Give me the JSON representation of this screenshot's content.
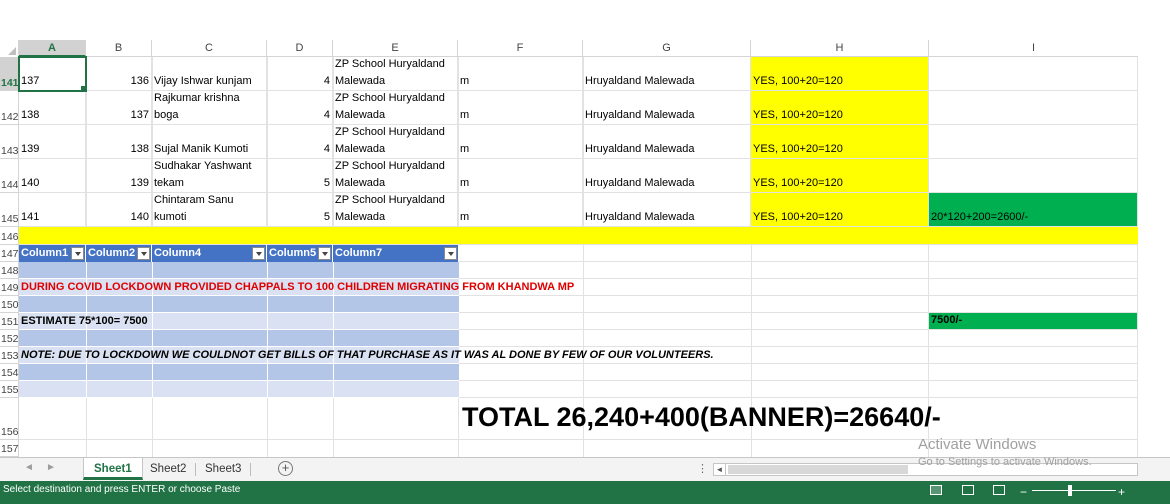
{
  "columns": [
    "A",
    "B",
    "C",
    "D",
    "E",
    "F",
    "G",
    "H",
    "I"
  ],
  "selected_column": "A",
  "rows": [
    {
      "num": "141",
      "a": "137",
      "b": "136",
      "c": [
        "Vijay Ishwar kunjam"
      ],
      "d": "4",
      "e": [
        "ZP School Huryaldand",
        "Malewada"
      ],
      "f": "m",
      "g": "Hruyaldand Malewada",
      "h": "YES, 100+20=120",
      "i": ""
    },
    {
      "num": "142",
      "a": "138",
      "b": "137",
      "c": [
        "Rajkumar krishna",
        "boga"
      ],
      "d": "4",
      "e": [
        "ZP School Huryaldand",
        "Malewada"
      ],
      "f": "m",
      "g": "Hruyaldand Malewada",
      "h": "YES, 100+20=120",
      "i": ""
    },
    {
      "num": "143",
      "a": "139",
      "b": "138",
      "c": [
        "Sujal Manik Kumoti"
      ],
      "d": "4",
      "e": [
        "ZP School Huryaldand",
        "Malewada"
      ],
      "f": "m",
      "g": "Hruyaldand Malewada",
      "h": "YES, 100+20=120",
      "i": ""
    },
    {
      "num": "144",
      "a": "140",
      "b": "139",
      "c": [
        "Sudhakar Yashwant",
        "tekam"
      ],
      "d": "5",
      "e": [
        "ZP School Huryaldand",
        "Malewada"
      ],
      "f": "m",
      "g": "Hruyaldand Malewada",
      "h": "YES, 100+20=120",
      "i": ""
    },
    {
      "num": "145",
      "a": "141",
      "b": "140",
      "c": [
        "Chintaram Sanu",
        "kumoti"
      ],
      "d": "5",
      "e": [
        "ZP School Huryaldand",
        "Malewada"
      ],
      "f": "m",
      "g": "Hruyaldand Malewada",
      "h": "YES, 100+20=120",
      "i": "20*120+200=2600/-"
    }
  ],
  "lower_row_numbers": [
    "146",
    "147",
    "148",
    "149",
    "150",
    "151",
    "152",
    "153",
    "154",
    "155",
    "156",
    "157"
  ],
  "table_headers": [
    "Column1",
    "Column2",
    "Column4",
    "Column5",
    "Column7"
  ],
  "lockdown_note": "DURING COVID LOCKDOWN PROVIDED CHAPPALS TO 100 CHILDREN MIGRATING FROM KHANDWA MP",
  "estimate": "ESTIMATE 75*100= 7500",
  "estimate_total": "7500/-",
  "bills_note": "NOTE: DUE TO LOCKDOWN WE COULDNOT GET BILLS OF THAT PURCHASE AS IT WAS AL DONE BY FEW OF OUR VOLUNTEERS.",
  "grand_total": "TOTAL 26,240+400(BANNER)=26640/-",
  "sheet_tabs": [
    "Sheet1",
    "Sheet2",
    "Sheet3"
  ],
  "active_tab": "Sheet1",
  "add_sheet_symbol": "+",
  "tab_nav": {
    "prev": "◄",
    "next": "►"
  },
  "tab_dots": "⋮",
  "scroll_left_symbol": "◄",
  "watermark": {
    "title": "Activate Windows",
    "subtitle": "Go to Settings to activate Windows."
  },
  "status_text": "Select destination and press ENTER or choose Paste",
  "zoom_controls": {
    "minus": "−",
    "plus": "+"
  },
  "colors": {
    "accent": "#217346",
    "yellow": "#ffff00",
    "green": "#00b050",
    "table_header": "#4472c4",
    "red_text": "#e00000"
  }
}
